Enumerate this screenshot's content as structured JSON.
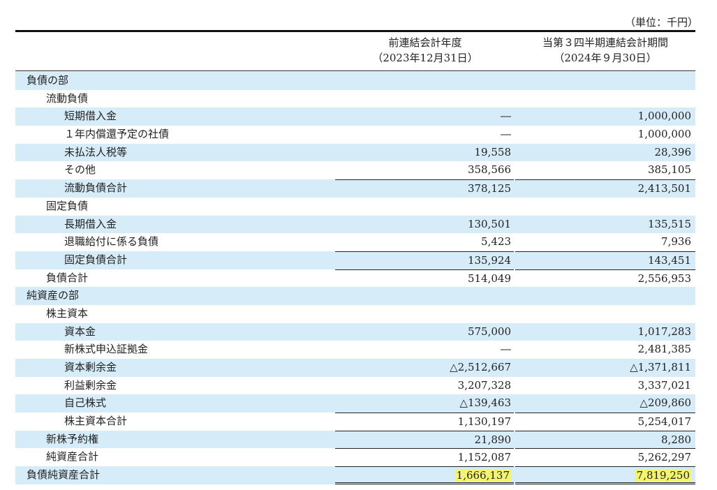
{
  "unit_label": "（単位：千円）",
  "header": {
    "prev_period_line1": "前連結会計年度",
    "prev_period_line2": "（2023年12月31日）",
    "curr_period_line1": "当第３四半期連結会計期間",
    "curr_period_line2": "（2024年９月30日）"
  },
  "rows": [
    {
      "label": "負債の部",
      "indent": 0,
      "prev": "",
      "curr": "",
      "shade": true,
      "rule": ""
    },
    {
      "label": "流動負債",
      "indent": 1,
      "prev": "",
      "curr": "",
      "shade": false,
      "rule": ""
    },
    {
      "label": "短期借入金",
      "indent": 2,
      "prev": "―",
      "curr": "1,000,000",
      "shade": true,
      "rule": ""
    },
    {
      "label": "１年内償還予定の社債",
      "indent": 2,
      "prev": "―",
      "curr": "1,000,000",
      "shade": false,
      "rule": ""
    },
    {
      "label": "未払法人税等",
      "indent": 2,
      "prev": "19,558",
      "curr": "28,396",
      "shade": true,
      "rule": ""
    },
    {
      "label": "その他",
      "indent": 2,
      "prev": "358,566",
      "curr": "385,105",
      "shade": false,
      "rule": ""
    },
    {
      "label": "流動負債合計",
      "indent": 2,
      "prev": "378,125",
      "curr": "2,413,501",
      "shade": true,
      "rule": "ul"
    },
    {
      "label": "固定負債",
      "indent": 1,
      "prev": "",
      "curr": "",
      "shade": false,
      "rule": ""
    },
    {
      "label": "長期借入金",
      "indent": 2,
      "prev": "130,501",
      "curr": "135,515",
      "shade": true,
      "rule": ""
    },
    {
      "label": "退職給付に係る負債",
      "indent": 2,
      "prev": "5,423",
      "curr": "7,936",
      "shade": false,
      "rule": ""
    },
    {
      "label": "固定負債合計",
      "indent": 2,
      "prev": "135,924",
      "curr": "143,451",
      "shade": true,
      "rule": "ul"
    },
    {
      "label": "負債合計",
      "indent": 0.5,
      "prev": "514,049",
      "curr": "2,556,953",
      "shade": false,
      "rule": "ul"
    },
    {
      "label": "純資産の部",
      "indent": 0,
      "prev": "",
      "curr": "",
      "shade": true,
      "rule": ""
    },
    {
      "label": "株主資本",
      "indent": 1,
      "prev": "",
      "curr": "",
      "shade": false,
      "rule": ""
    },
    {
      "label": "資本金",
      "indent": 2,
      "prev": "575,000",
      "curr": "1,017,283",
      "shade": true,
      "rule": ""
    },
    {
      "label": "新株式申込証拠金",
      "indent": 2,
      "prev": "―",
      "curr": "2,481,385",
      "shade": false,
      "rule": ""
    },
    {
      "label": "資本剰余金",
      "indent": 2,
      "prev": "△2,512,667",
      "curr": "△1,371,811",
      "shade": true,
      "rule": ""
    },
    {
      "label": "利益剰余金",
      "indent": 2,
      "prev": "3,207,328",
      "curr": "3,337,021",
      "shade": false,
      "rule": ""
    },
    {
      "label": "自己株式",
      "indent": 2,
      "prev": "△139,463",
      "curr": "△209,860",
      "shade": true,
      "rule": ""
    },
    {
      "label": "株主資本合計",
      "indent": 2,
      "prev": "1,130,197",
      "curr": "5,254,017",
      "shade": false,
      "rule": "ul"
    },
    {
      "label": "新株予約権",
      "indent": 1,
      "prev": "21,890",
      "curr": "8,280",
      "shade": true,
      "rule": "ul"
    },
    {
      "label": "純資産合計",
      "indent": 1,
      "prev": "1,152,087",
      "curr": "5,262,297",
      "shade": false,
      "rule": "ul"
    },
    {
      "label": "負債純資産合計",
      "indent": 0,
      "prev": "1,666,137",
      "curr": "7,819,250",
      "shade": true,
      "rule": "dbl",
      "highlight": true
    }
  ]
}
